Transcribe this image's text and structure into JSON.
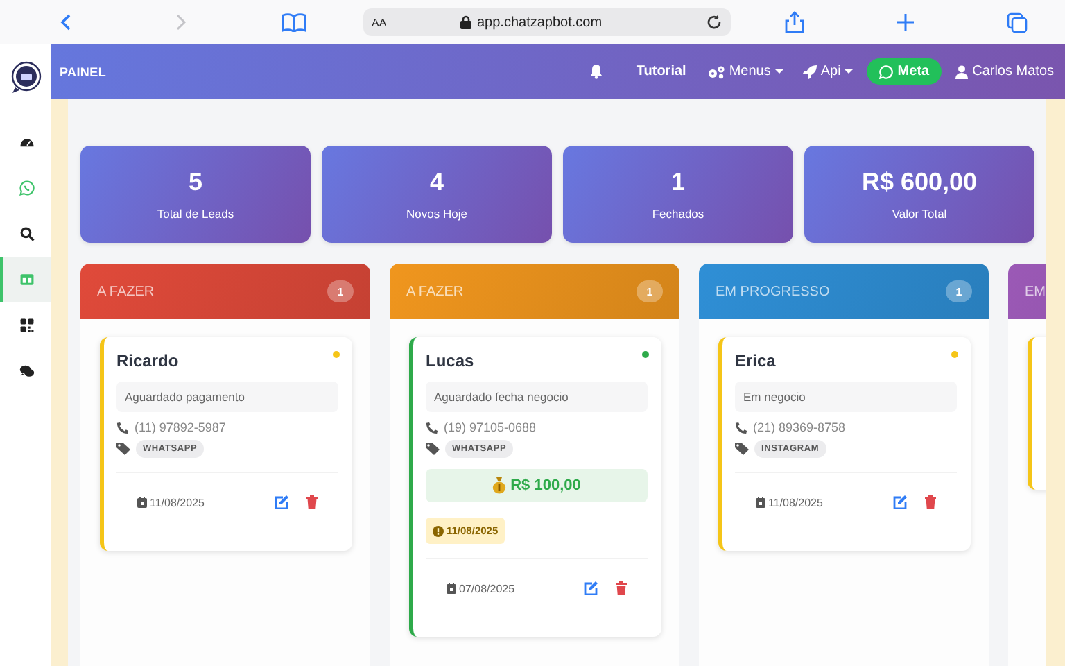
{
  "browser": {
    "text_size": "AA",
    "url": "app.chatzapbot.com",
    "forward_disabled": true
  },
  "navbar": {
    "title": "PAINEL",
    "items": [
      {
        "kind": "notifications"
      },
      {
        "kind": "tutorial",
        "label": "Tutorial"
      },
      {
        "kind": "menus",
        "label": "Menus"
      },
      {
        "kind": "api",
        "label": "Api"
      },
      {
        "kind": "meta",
        "label": "Meta"
      },
      {
        "kind": "account",
        "label": "Carlos Matos"
      }
    ]
  },
  "sidebar": {
    "items": [
      {
        "kind": "dashboard",
        "selected": false
      },
      {
        "kind": "whatsapp",
        "selected": false
      },
      {
        "kind": "search",
        "selected": false
      },
      {
        "kind": "board",
        "selected": true
      },
      {
        "kind": "grid",
        "selected": false
      },
      {
        "kind": "chat",
        "selected": false
      }
    ]
  },
  "stats": [
    {
      "value": "5",
      "label": "Total de Leads"
    },
    {
      "value": "4",
      "label": "Novos Hoje"
    },
    {
      "value": "1",
      "label": "Fechados"
    },
    {
      "value": "R$ 600,00",
      "label": "Valor Total"
    }
  ],
  "columns": [
    {
      "title": "A FAZER",
      "count": "1",
      "color": "#e04a3a",
      "cards": [
        {
          "name": "Ricardo",
          "color": "#f5c518",
          "note": "Aguardado pagamento",
          "phone": "(11) 97892-5987",
          "tag": "WHATSAPP",
          "date": "11/08/2025"
        }
      ]
    },
    {
      "title": "A FAZER",
      "count": "1",
      "color": "#f0961e",
      "cards": [
        {
          "name": "Lucas",
          "color": "#2eaa4a",
          "note": "Aguardado fecha negocio",
          "phone": "(19) 97105-0688",
          "tag": "WHATSAPP",
          "value": "R$ 100,00",
          "due": "11/08/2025",
          "date": "07/08/2025"
        }
      ]
    },
    {
      "title": "EM PROGRESSO",
      "count": "1",
      "color": "#2f8fd6",
      "cards": [
        {
          "name": "Erica",
          "color": "#f5c518",
          "note": "Em negocio",
          "phone": "(21) 89369-8758",
          "tag": "INSTAGRAM",
          "date": "11/08/2025"
        }
      ]
    },
    {
      "title": "EM",
      "color": "#9b59b6",
      "cards": [
        {
          "kind": "stub",
          "color": "#f5c518"
        }
      ]
    }
  ]
}
